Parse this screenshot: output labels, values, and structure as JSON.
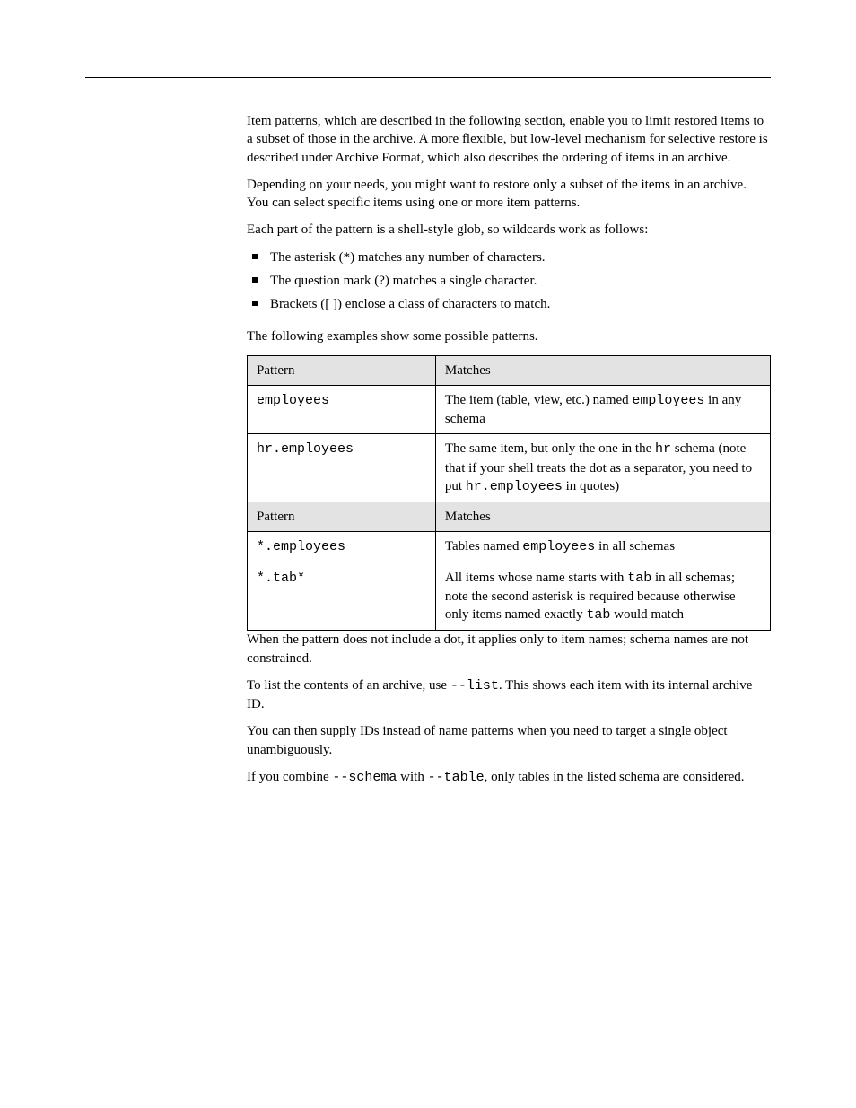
{
  "para": {
    "intro1": "Item patterns, which are described in the following section, enable you to limit restored items to a subset of those in the archive. A more flexible, but low-level mechanism for selective restore is described under Archive Format, which also describes the ordering of items in an archive.",
    "intro2": "Depending on your needs, you might want to restore only a subset of the items in an archive. You can select specific items using one or more item patterns.",
    "intro3": "Each part of the pattern is a shell-style glob, so wildcards work as follows:"
  },
  "bullets": [
    "The asterisk (*) matches any number of characters.",
    "The question mark (?) matches a single character.",
    "Brackets ([ ]) enclose a class of characters to match."
  ],
  "preTable": "The following examples show some possible patterns.",
  "table": {
    "h1a": "Pattern",
    "h1b": "Matches",
    "r1a": "employees",
    "r1b_a": "The item (table, view, etc.) named ",
    "r1b_code": "employees",
    "r1b_b": " in any schema",
    "r2a": "hr.employees",
    "r2b_a": "The same item, but only the one in the ",
    "r2b_code1": "hr",
    "r2b_b": " schema (note that if your shell treats the dot as a separator, you need to put ",
    "r2b_code2": "hr.employees",
    "r2b_c": " in quotes)",
    "h2a": "Pattern",
    "h2b": "Matches",
    "r3a": "*.employees",
    "r3b_a": "Tables named ",
    "r3b_code": "employees",
    "r3b_b": " in all schemas",
    "r4a": "*.tab*",
    "r4b_a": "All items whose name starts with ",
    "r4b_code1": "tab",
    "r4b_b": " in all schemas; note the second asterisk is required because otherwise only items named exactly ",
    "r4b_code2": "tab",
    "r4b_c": " would match"
  },
  "after": {
    "p1": "When the pattern does not include a dot, it applies only to item names; schema names are not constrained.",
    "p2a": "To list the contents of an archive, use ",
    "p2code": "--list",
    "p2b": ". This shows each item with its internal archive ID.",
    "p3": "You can then supply IDs instead of name patterns when you need to target a single object unambiguously.",
    "p4a": "If you combine ",
    "p4code1": "--schema",
    "p4b": " with ",
    "p4code2": "--table",
    "p4c": ", only tables in the listed schema are considered."
  }
}
